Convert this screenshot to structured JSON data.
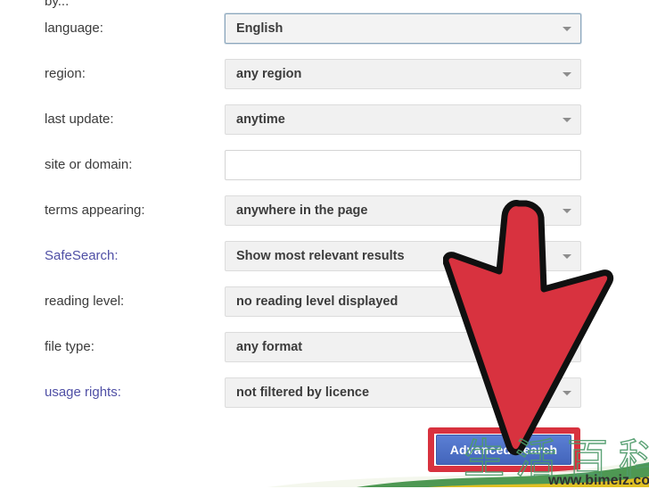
{
  "page": {
    "partial_top_text": "by...",
    "background_color": "#ffffff"
  },
  "form": {
    "rows": [
      {
        "label": "language:",
        "label_is_link": false,
        "control": "select",
        "value": "English",
        "focused": true,
        "icon": "chevron-down-icon",
        "name": "language"
      },
      {
        "label": "region:",
        "label_is_link": false,
        "control": "select",
        "value": "any region",
        "focused": false,
        "icon": "chevron-down-icon",
        "name": "region"
      },
      {
        "label": "last update:",
        "label_is_link": false,
        "control": "select",
        "value": "anytime",
        "focused": false,
        "icon": "chevron-down-icon",
        "name": "last-update"
      },
      {
        "label": "site or domain:",
        "label_is_link": false,
        "control": "text",
        "value": "",
        "placeholder": "",
        "focused": false,
        "name": "site-or-domain"
      },
      {
        "label": "terms appearing:",
        "label_is_link": false,
        "control": "select",
        "value": "anywhere in the page",
        "focused": false,
        "icon": "chevron-down-icon",
        "name": "terms-appearing"
      },
      {
        "label": "SafeSearch:",
        "label_is_link": true,
        "control": "select",
        "value": "Show most relevant results",
        "focused": false,
        "icon": "chevron-down-icon",
        "name": "safesearch"
      },
      {
        "label": "reading level:",
        "label_is_link": false,
        "control": "select",
        "value": "no reading level displayed",
        "focused": false,
        "icon": "chevron-down-icon",
        "name": "reading-level"
      },
      {
        "label": "file type:",
        "label_is_link": false,
        "control": "select",
        "value": "any format",
        "focused": false,
        "icon": "chevron-down-icon",
        "name": "file-type"
      },
      {
        "label": "usage rights:",
        "label_is_link": true,
        "control": "select",
        "value": "not filtered by licence",
        "focused": false,
        "icon": "chevron-down-icon",
        "name": "usage-rights"
      }
    ],
    "submit_label": "Advanced Search"
  },
  "annotations": {
    "arrow_color": "#d8323f",
    "arrow_outline_color": "#101010",
    "highlight_color": "#d8323f"
  },
  "watermark": {
    "characters": "生活百科",
    "url": "www.bimeiz.com",
    "stroke_color": "#4f9b6b"
  },
  "colors": {
    "link": "#4f4fa5",
    "label": "#3b3b3b",
    "select_bg": "#f1f1f1",
    "select_border": "#dcdcdc",
    "focus_border": "#8ba7bd",
    "button_blue": "#4d72c8",
    "accent_red": "#d8323f"
  }
}
